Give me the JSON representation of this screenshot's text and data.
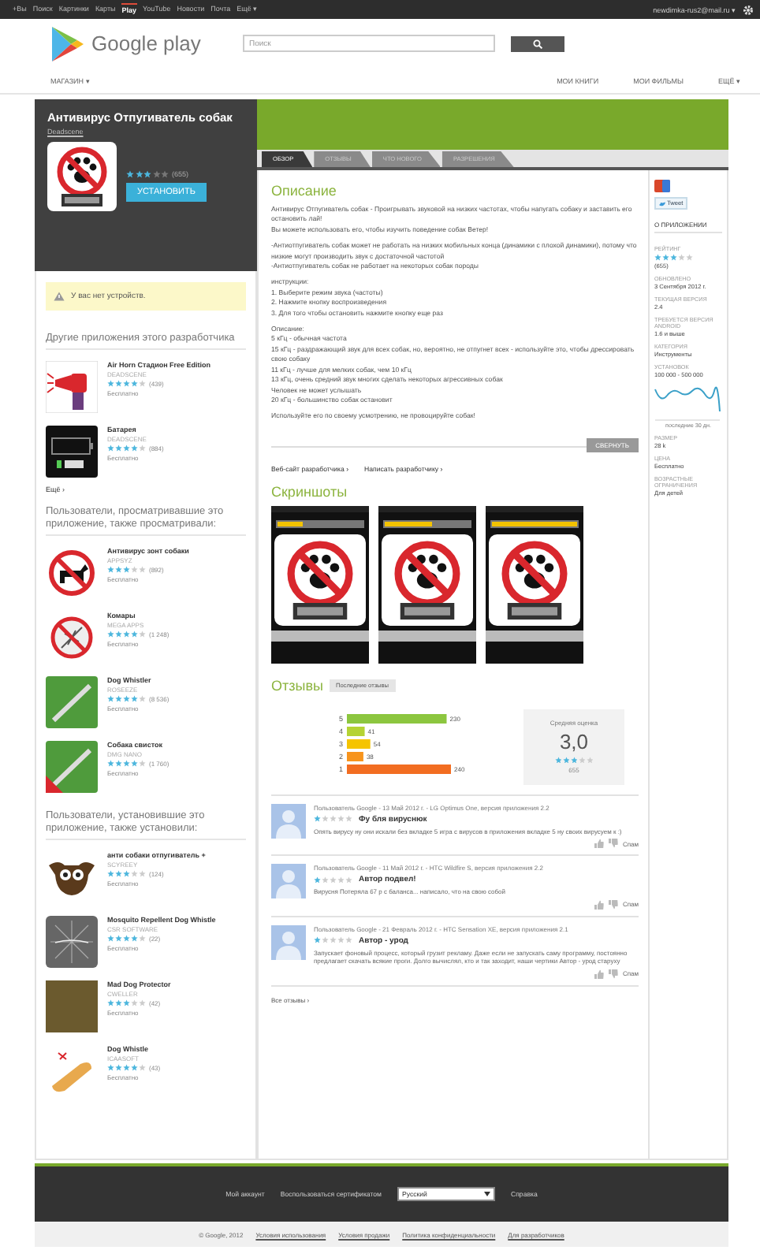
{
  "top_bar": {
    "links": [
      {
        "label": "+Вы",
        "selected": false
      },
      {
        "label": "Поиск",
        "selected": false
      },
      {
        "label": "Картинки",
        "selected": false
      },
      {
        "label": "Карты",
        "selected": false
      },
      {
        "label": "Play",
        "selected": true
      },
      {
        "label": "YouTube",
        "selected": false
      },
      {
        "label": "Новости",
        "selected": false
      },
      {
        "label": "Почта",
        "selected": false
      },
      {
        "label": "Ещё ▾",
        "selected": false
      }
    ],
    "account": "newdimka-rus2@mail.ru ▾"
  },
  "header": {
    "logo_text": "Google play",
    "search": {
      "placeholder": "Поиск"
    }
  },
  "nav": {
    "store": "МАГАЗИН ▾",
    "links": [
      "МОИ КНИГИ",
      "МОИ ФИЛЬМЫ",
      "ЕЩЁ ▾"
    ]
  },
  "app": {
    "title": "Антивирус Отпугиватель собак",
    "developer": "Deadscene",
    "stars": 3,
    "count": "(655)",
    "install_button": "УСТАНОВИТЬ"
  },
  "warning": "У вас нет устройств.",
  "sidebar": {
    "sections": [
      {
        "title": "Другие приложения этого разработчика",
        "apps": [
          {
            "kind": "horn",
            "name": "Air Horn Стадион Free Edition",
            "developer": "DEADSCENE",
            "stars": 4,
            "count": "(439)",
            "price": "Бесплатно"
          },
          {
            "kind": "battery",
            "name": "Батарея",
            "developer": "DEADSCENE",
            "stars": 4,
            "count": "(884)",
            "price": "Бесплатно"
          }
        ],
        "more": "Ещё ›"
      },
      {
        "title": "Пользователи, просматривавшие это приложение, также просматривали:",
        "apps": [
          {
            "kind": "no-dog",
            "name": "Антивирус зонт собаки",
            "developer": "APPSYZ",
            "stars": 3,
            "count": "(892)",
            "price": "Бесплатно"
          },
          {
            "kind": "no-mosquito",
            "name": "Комары",
            "developer": "MEGA APPS",
            "stars": 4,
            "count": "(1 248)",
            "price": "Бесплатно"
          },
          {
            "kind": "whistle",
            "name": "Dog Whistler",
            "developer": "ROSEEZE",
            "stars": 4,
            "count": "(8 536)",
            "price": "Бесплатно"
          },
          {
            "kind": "whistle-ribbon",
            "name": "Собака свисток",
            "developer": "DMG NANO",
            "stars": 4,
            "count": "(1 760)",
            "price": "Бесплатно"
          }
        ]
      },
      {
        "title": "Пользователи, установившие это приложение, также установили:",
        "apps": [
          {
            "kind": "dog-face",
            "name": "анти собаки отпугиватель +",
            "developer": "SCYREEY",
            "stars": 3,
            "count": "(124)",
            "price": "Бесплатно"
          },
          {
            "kind": "web",
            "name": "Mosquito Repellent Dog Whistle",
            "developer": "CSR SOFTWARE",
            "stars": 4,
            "count": "(22)",
            "price": "Бесплатно"
          },
          {
            "kind": "photo",
            "name": "Mad Dog Protector",
            "developer": "CWELLER",
            "stars": 3,
            "count": "(42)",
            "price": "Бесплатно"
          },
          {
            "kind": "flute",
            "name": "Dog Whistle",
            "developer": "ICAASOFT",
            "stars": 4,
            "count": "(43)",
            "price": "Бесплатно"
          }
        ]
      }
    ]
  },
  "tabs": [
    {
      "label": "ОБЗОР",
      "selected": true
    },
    {
      "label": "ОТЗЫВЫ",
      "selected": false
    },
    {
      "label": "ЧТО НОВОГО",
      "selected": false
    },
    {
      "label": "РАЗРЕШЕНИЯ",
      "selected": false
    }
  ],
  "description": {
    "title": "Описание",
    "paragraphs": [
      "Антивирус Отпугиватель собак - Проигрывать звуковой на низких частотах, чтобы напугать собаку и заставить его остановить лай!\nВы можете использовать его, чтобы изучить поведение собак Ветер!",
      "-Антиотпугиватель собак может не работать на низких мобильных конца (динамики с плохой динамики), потому что низкие могут производить звук с достаточной частотой\n-Антиотпугиватель собак не работает на некоторых собак породы",
      "инструкции:\n1. Выберите режим звука (частоты)\n2. Нажмите кнопку воспроизведения\n3. Для того чтобы остановить нажмите кнопку еще раз",
      "Описание:\n5 кГц - обычная частота\n15 кГц - раздражающий звук для всех собак, но, вероятно, не отпугнет всех - используйте это, чтобы дрессировать свою собаку\n11 кГц - лучше для мелких собак, чем 10 кГц\n13 кГц, очень средний звук многих сделать некоторых агрессивных собак\nЧеловек не может услышать\n20 кГц - большинство собак остановит",
      "Используйте его по своему усмотрению, не провоцируйте собак!"
    ],
    "collapse_button": "СВЕРНУТЬ",
    "links": [
      "Веб-сайт разработчика ›",
      "Написать разработчику ›"
    ]
  },
  "screenshots": {
    "title": "Скриншоты",
    "items": [
      {
        "level": 0.3
      },
      {
        "level": 0.55
      },
      {
        "level": 1
      }
    ]
  },
  "reviews": {
    "title": "Отзывы",
    "sort_button": "Последние отзывы",
    "chart_data": {
      "type": "bar",
      "orientation": "horizontal",
      "categories": [
        "5",
        "4",
        "3",
        "2",
        "1"
      ],
      "values": [
        230,
        41,
        54,
        38,
        240
      ],
      "data_labels": true
    },
    "average": {
      "label": "Средняя оценка",
      "value": "3,0",
      "stars": 3,
      "count": "655"
    },
    "items": [
      {
        "meta": "Пользователь Google - 13 Май 2012 г. - LG Optimus One, версия приложения 2.2",
        "stars": 1,
        "title": "Фу бля вируснюк",
        "text": "Опять вирусу ну они искали без вкладке 5 игра с вирусов в приложения вкладке 5 ну своих вирусуем к :)",
        "spam": "Спам"
      },
      {
        "meta": "Пользователь Google - 11 Май 2012 г. - HTC Wildfire S, версия приложения 2.2",
        "stars": 1,
        "title": "Автор подвел!",
        "text": "Вирусня Потеряла 67 р с баланса... написало, что на свою собой",
        "spam": "Спам"
      },
      {
        "meta": "Пользователь Google - 21 Февраль 2012 г. - HTC Sensation XE, версия приложения 2.1",
        "stars": 1,
        "title": "Автор - урод",
        "text": "Запускает фоновый процесс, который грузит рекламу. Даже если не запускать саму программу, постоянно предлагает скачать всякие проги. Долго вычислял, кто и так заходит, наши чертики Автор - урод старуху",
        "spam": "Спам"
      }
    ],
    "all_reviews": "Все отзывы ›"
  },
  "meta": {
    "tweet": "Tweet",
    "title": "О ПРИЛОЖЕНИИ",
    "fields": [
      {
        "kind": "stars",
        "label": "РЕЙТИНГ",
        "stars": 3,
        "value": "(655)"
      },
      {
        "kind": "text",
        "label": "ОБНОВЛЕНО",
        "value": "3 Сентября 2012 г."
      },
      {
        "kind": "text",
        "label": "ТЕКУЩАЯ ВЕРСИЯ",
        "value": "2.4"
      },
      {
        "kind": "text",
        "label": "ТРЕБУЕТСЯ ВЕРСИЯ ANDROID",
        "value": "1.6 и выше"
      },
      {
        "kind": "text",
        "label": "КАТЕГОРИЯ",
        "value": "Инструменты"
      },
      {
        "kind": "graph",
        "label": "УСТАНОВОК",
        "value": "100 000 - 500 000",
        "caption": "последние 30 дн."
      },
      {
        "kind": "text",
        "label": "РАЗМЕР",
        "value": "28 k"
      },
      {
        "kind": "text",
        "label": "ЦЕНА",
        "value": "Бесплатно"
      },
      {
        "kind": "text",
        "label": "ВОЗРАСТНЫЕ ОГРАНИЧЕНИЯ",
        "value": "Для детей"
      }
    ]
  },
  "footer": {
    "links": [
      "Мой аккаунт",
      "Воспользоваться сертификатом"
    ],
    "language": "Русский",
    "help": "Справка",
    "copyright": "© Google, 2012",
    "bottom_links": [
      "Условия использования",
      "Условия продажи",
      "Политика конфиденциальности",
      "Для разработчиков"
    ]
  }
}
